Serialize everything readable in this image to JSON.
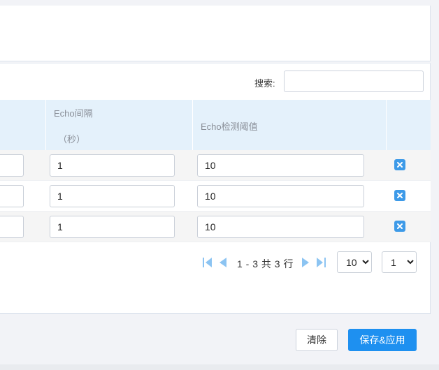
{
  "search": {
    "label": "搜索:",
    "value": ""
  },
  "table": {
    "headers": [
      "",
      "Echo间隔",
      "（秒）",
      "Echo检测阈值",
      ""
    ],
    "rows": [
      {
        "partial": "",
        "interval": "1",
        "threshold": "10"
      },
      {
        "partial": "",
        "interval": "1",
        "threshold": "10"
      },
      {
        "partial": "",
        "interval": "1",
        "threshold": "10"
      }
    ]
  },
  "pagination": {
    "summary": "1 - 3 共 3 行",
    "page_size": "10",
    "page": "1"
  },
  "actions": {
    "clear": "清除",
    "save": "保存&应用"
  },
  "colors": {
    "accent": "#1e90f0",
    "header_bg": "#e4f1fb",
    "icon_blue": "#3d9ae8",
    "pager_icon": "#8cc4f2"
  }
}
